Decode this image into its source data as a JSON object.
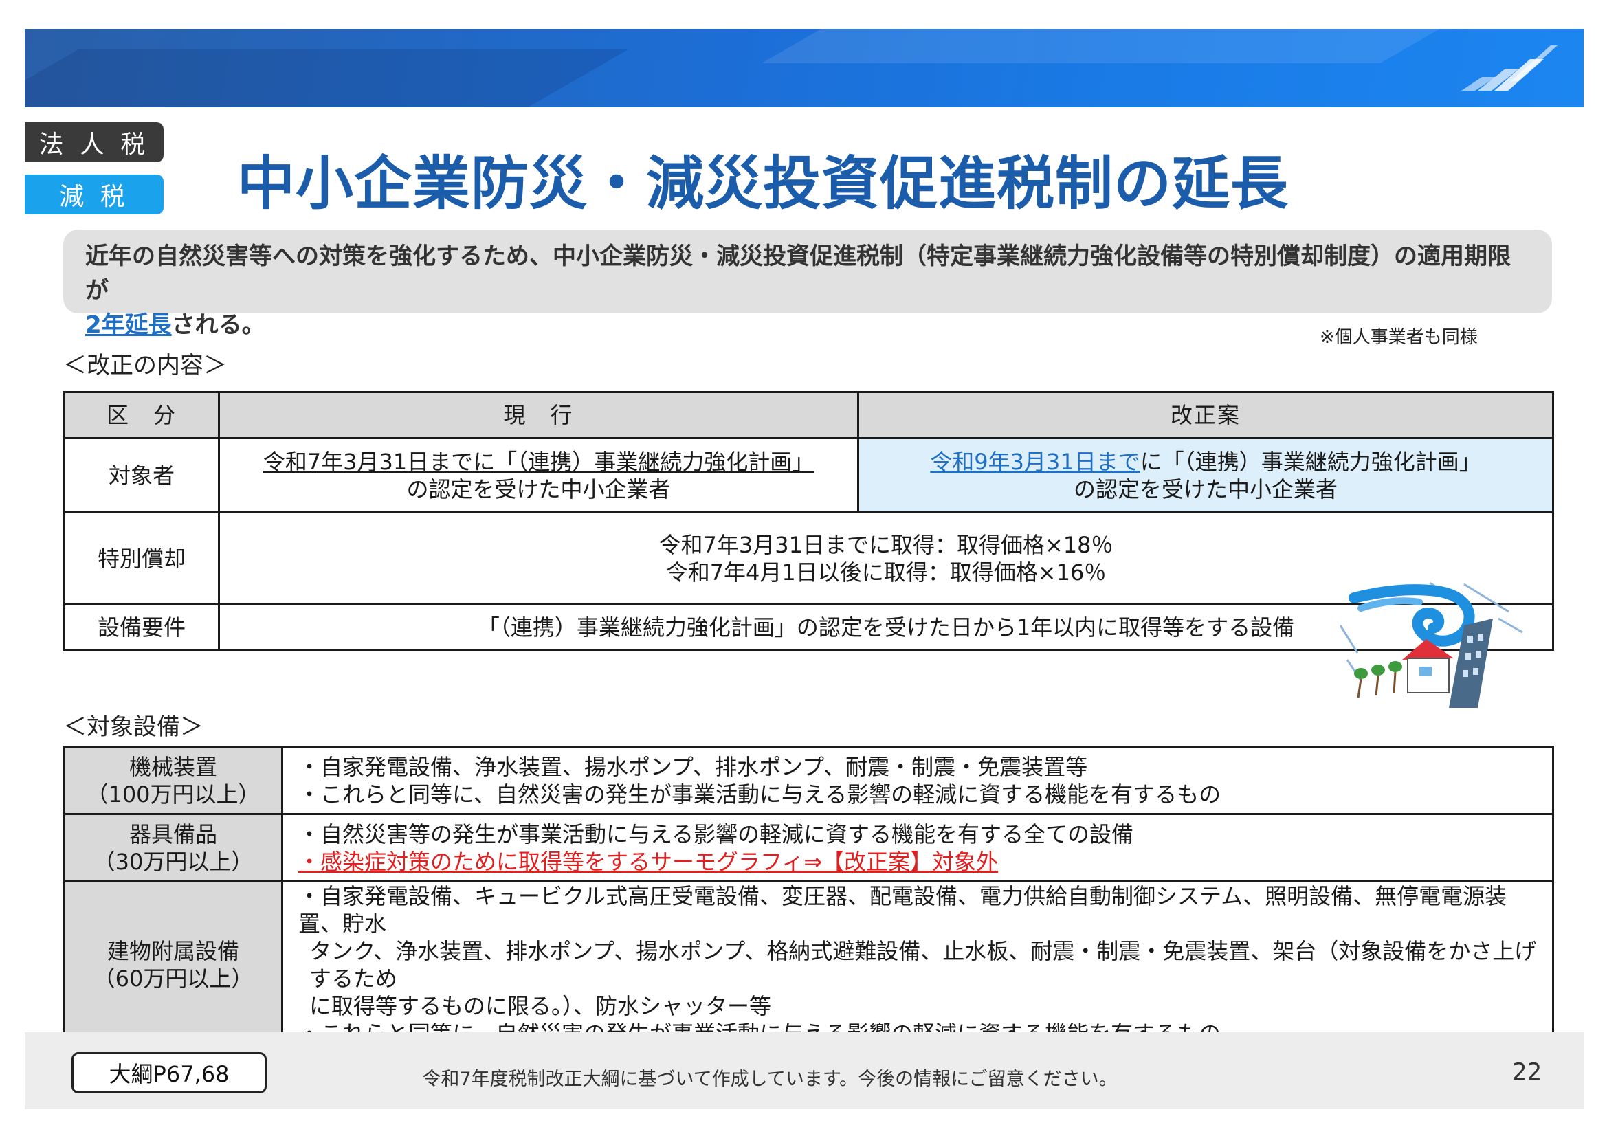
{
  "tags": {
    "category": "法 人 税",
    "type": "減 税"
  },
  "title": "中小企業防災・減災投資促進税制の延長",
  "summary": {
    "line1": "近年の自然災害等への対策を強化するため、中小企業防災・減災投資促進税制（特定事業継続力強化設備等の特別償却制度）の適用期限が",
    "highlight": "2年延長",
    "line2_rest": "される。"
  },
  "note": "※個人事業者も同様",
  "section1_title": "＜改正の内容＞",
  "reform_table": {
    "headers": {
      "category": "区　分",
      "current": "現　行",
      "proposal": "改正案"
    },
    "target": {
      "label": "対象者",
      "current_line1": "令和7年3月31日までに「（連携）事業継続力強化計画」",
      "current_line2": "の認定を受けた中小企業者",
      "proposal_highlight": "令和9年3月31日まで",
      "proposal_line1_rest": "に「（連携）事業継続力強化計画」",
      "proposal_line2": "の認定を受けた中小企業者"
    },
    "depreciation": {
      "label": "特別償却",
      "line1": "令和7年3月31日までに取得：取得価格×18％",
      "line2": "令和7年4月1日以後に取得：取得価格×16％"
    },
    "equipment_req": {
      "label": "設備要件",
      "text": "「（連携）事業継続力強化計画」の認定を受けた日から1年以内に取得等をする設備"
    }
  },
  "section2_title": "＜対象設備＞",
  "equipment_table": [
    {
      "cat_line1": "機械装置",
      "cat_line2": "（100万円以上）",
      "line1": "・自家発電設備、浄水装置、揚水ポンプ、排水ポンプ、耐震・制震・免震装置等",
      "line2": "・これらと同等に、自然災害の発生が事業活動に与える影響の軽減に資する機能を有するもの"
    },
    {
      "cat_line1": "器具備品",
      "cat_line2": "（30万円以上）",
      "line1": "・自然災害等の発生が事業活動に与える影響の軽減に資する機能を有する全ての設備",
      "line2_red": "・感染症対策のために取得等をするサーモグラフィ⇒【改正案】対象外"
    },
    {
      "cat_line1": "建物附属設備",
      "cat_line2": "（60万円以上）",
      "line1": "・自家発電設備、キュービクル式高圧受電設備、変圧器、配電設備、電力供給自動制御システム、照明設備、無停電電源装置、貯水",
      "line2": "タンク、浄水装置、排水ポンプ、揚水ポンプ、格納式避難設備、止水板、耐震・制震・免震装置、架台（対象設備をかさ上げするため",
      "line3": "に取得等するものに限る。）、防水シャッター等",
      "line4": "・これらと同等に、自然災害の発生が事業活動に与える影響の軽減に資する機能を有するもの"
    }
  ],
  "footer": {
    "reference": "大綱P67,68",
    "note": "令和7年度税制改正大綱に基づいて作成しています。今後の情報にご留意ください。",
    "page_number": "22"
  },
  "colors": {
    "title": "#1b5dab",
    "header_band": "#1c6ed6",
    "tag_dark": "#3a3a3a",
    "tag_blue": "#1aa3ec",
    "highlight_blue": "#1f6fc5",
    "warning_red": "#e02020",
    "proposal_cell": "#ddeffa"
  },
  "icons": {
    "illustration": "typhoon-house-illustration",
    "header_logo": "stripes-logo-icon"
  }
}
